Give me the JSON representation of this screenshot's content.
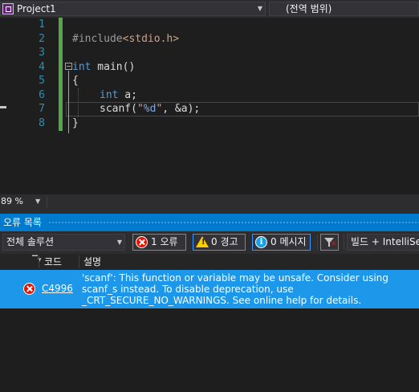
{
  "navbar": {
    "project": "Project1",
    "scope": "(전역 범위)"
  },
  "editor": {
    "line_numbers": [
      "1",
      "2",
      "3",
      "4",
      "5",
      "6",
      "7",
      "8"
    ],
    "lines": {
      "l2_pp": "#include",
      "l2_inc": "<stdio.h>",
      "l4_kw": "int",
      "l4_rest": " main()",
      "l5": "{",
      "l6_kw": "int",
      "l6_rest": " a;",
      "l7_a": "scanf(",
      "l7_q1": "\"",
      "l7_fmt": "%d",
      "l7_q2": "\"",
      "l7_b": ", &a);",
      "l8": "}"
    }
  },
  "zoom": {
    "value": "89 %"
  },
  "error_list": {
    "title": "오류 목록",
    "scope": "전체 솔루션",
    "errors_label": "1 오류",
    "warnings_label": "0 경고",
    "messages_label": "0 메시지",
    "build_label": "빌드 + IntelliSense",
    "columns": {
      "code": "코드",
      "description": "설명"
    },
    "rows": [
      {
        "code": "C4996",
        "description": "'scanf': This function or variable may be unsafe. Consider using scanf_s instead. To disable deprecation, use _CRT_SECURE_NO_WARNINGS. See online help for details."
      }
    ]
  },
  "colors": {
    "accent": "#007acc",
    "selected_row": "#1c97ea",
    "error": "#e51400",
    "line_number": "#2b91af",
    "keyword": "#569cd6",
    "string": "#d69d85",
    "change_margin": "#57a64a"
  }
}
